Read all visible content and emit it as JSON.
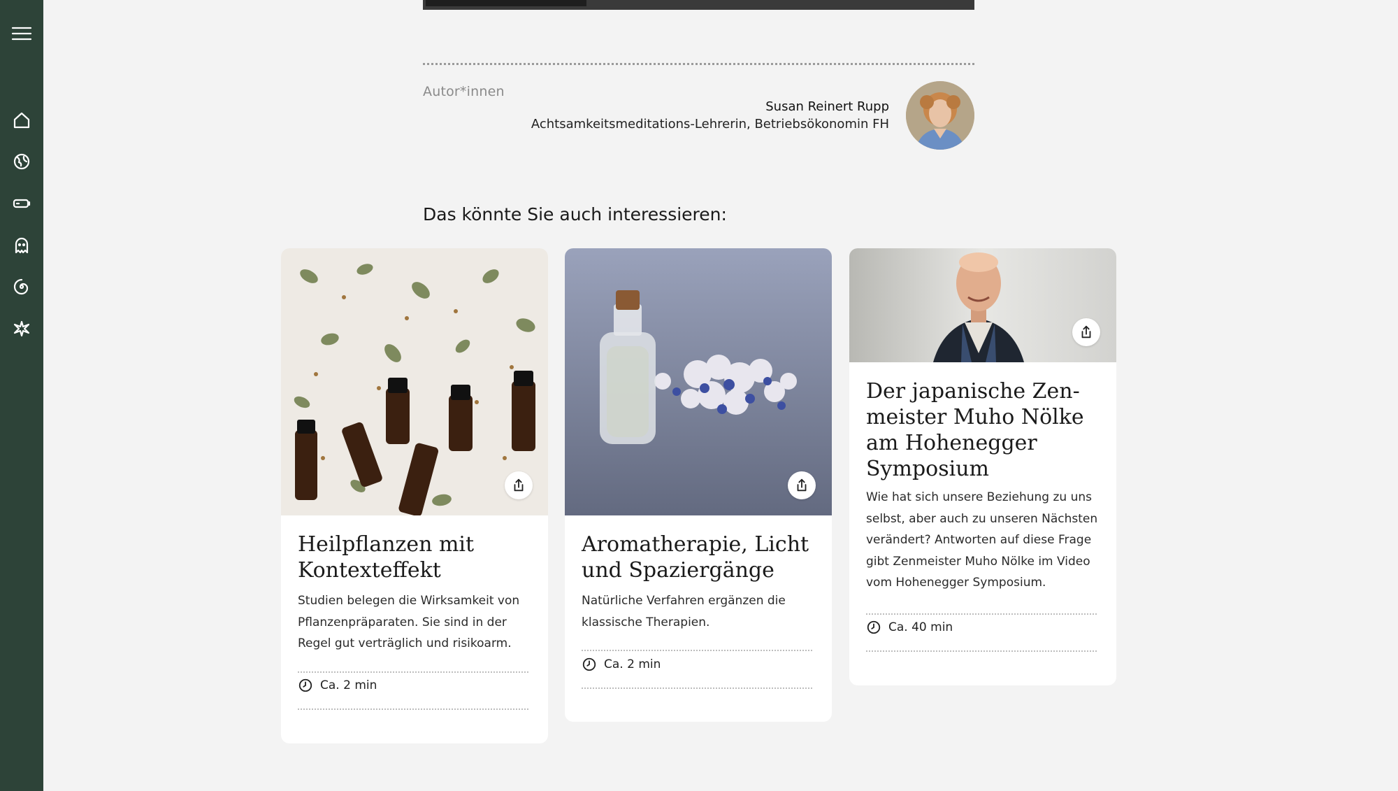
{
  "sidebar": {
    "menu_icon": "hamburger-menu-icon",
    "nav_icons": [
      "home-icon",
      "globe-icon",
      "battery-icon",
      "ghost-icon",
      "spiral-icon",
      "burst-icon"
    ]
  },
  "author_section": {
    "label": "Autor*innen",
    "name": "Susan Reinert Rupp",
    "role": "Achtsamkeitsmeditations-Lehrerin, Betriebsökonomin FH"
  },
  "related": {
    "heading": "Das könnte Sie auch interessieren:",
    "cards": [
      {
        "title": "Heilpflanzen mit Kontexteffekt",
        "description": "Studien belegen die Wirksamkeit von Pflanzenpräparaten. Sie sind in der Regel gut verträglich und risikoarm.",
        "time": "Ca. 2 min"
      },
      {
        "title": "Aromatherapie, Licht und Spaziergänge",
        "description": "Natürliche Verfahren ergänzen die klassische Therapien.",
        "time": "Ca. 2 min"
      },
      {
        "title": "Der japanische Zen-meister Muho Nölke am Hohenegger Symposium",
        "description": "Wie hat sich unsere Beziehung zu uns selbst, aber auch zu unseren Nächsten verändert? Antworten auf diese Frage gibt Zenmeister Muho Nölke im Video vom Hohenegger Symposium.",
        "time": "Ca. 40 min"
      }
    ]
  },
  "colors": {
    "sidebar": "#2d4338",
    "page_background": "#f3f3f3",
    "card_background": "#ffffff"
  }
}
